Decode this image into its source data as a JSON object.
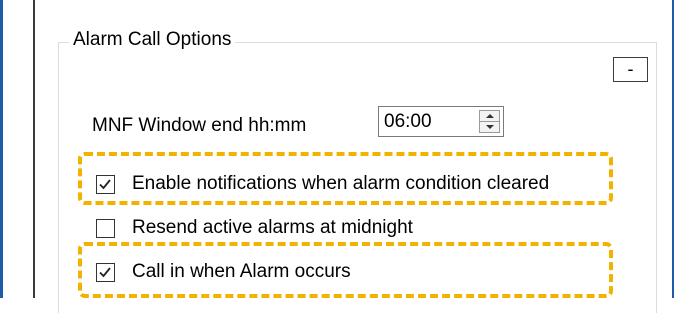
{
  "group": {
    "title": "Alarm Call Options",
    "collapse_label": "-"
  },
  "mnf_window": {
    "label": "MNF Window end hh:mm",
    "value": "06:00"
  },
  "checkboxes": [
    {
      "label": "Enable notifications when alarm condition cleared",
      "checked": true,
      "highlighted": true
    },
    {
      "label": "Resend active alarms at midnight",
      "checked": false,
      "highlighted": false
    },
    {
      "label": "Call in when Alarm occurs",
      "checked": true,
      "highlighted": true
    }
  ],
  "colors": {
    "highlight": "#f2b300",
    "window_edge": "#1e5aa8"
  },
  "icons": {
    "check": "check-mark-icon",
    "spin_up": "spin-up-arrow-icon",
    "spin_down": "spin-down-arrow-icon"
  }
}
